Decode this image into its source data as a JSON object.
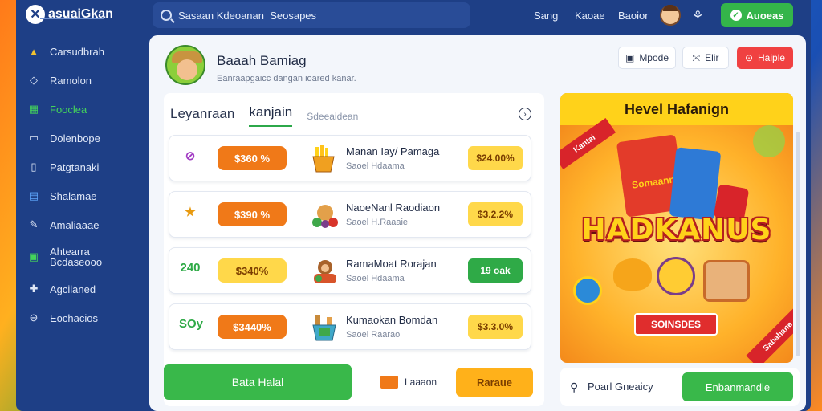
{
  "app": {
    "name": "asuaiGkan"
  },
  "search": {
    "placeholder": "Sasaan Kdeoanan  Seosapes"
  },
  "topnav": {
    "links": [
      "Sang",
      "Kaoae",
      "Baoior"
    ],
    "cta": "Auoeas"
  },
  "sidebar": {
    "items": [
      {
        "label": "Carsudbrah",
        "icon": "hat-icon"
      },
      {
        "label": "Ramolon",
        "icon": "flag-icon"
      },
      {
        "label": "Fooclea",
        "icon": "chart-icon",
        "active": true
      },
      {
        "label": "Dolenbope",
        "icon": "card-icon"
      },
      {
        "label": "Patgtanaki",
        "icon": "doc-icon"
      },
      {
        "label": "Shalamae",
        "icon": "grid-icon"
      },
      {
        "label": "Amaliaaae",
        "icon": "pen-icon"
      },
      {
        "label": "Ahtearra\nBcdaseooo",
        "icon": "image-icon"
      },
      {
        "label": "Agcilaned",
        "icon": "puzzle-icon"
      },
      {
        "label": "Eochacios",
        "icon": "minus-circle-icon"
      }
    ]
  },
  "profile": {
    "name": "Baaah Bamiag",
    "subtitle": "Eanraapgaicc dangan ioared kanar."
  },
  "header_buttons": {
    "mode": "Mpode",
    "edit": "Elir",
    "help": "Haiple"
  },
  "tabs": {
    "items": [
      "Leyanraan",
      "kanjain",
      "Sdeeaidean"
    ]
  },
  "rows": [
    {
      "lead": "",
      "lead_icon": "refresh-icon",
      "pill": "$360 %",
      "pill_style": "orange",
      "thumb": "fries-icon",
      "title": "Manan Iay/ Pamaga",
      "sub": "Saoel Hdaama",
      "badge": "$24.00%",
      "badge_style": "yellow"
    },
    {
      "lead": "",
      "lead_icon": "star-icon",
      "pill": "$390 %",
      "pill_style": "orange",
      "thumb": "creature-icon",
      "title": "NaoeNanl Raodiaon",
      "sub": "Saoel H.Raaaie",
      "badge": "$3.2.2%",
      "badge_style": "yellow"
    },
    {
      "lead": "240",
      "lead_icon": "",
      "pill": "$340%",
      "pill_style": "yellow",
      "thumb": "monkey-icon",
      "title": "RamaMoat Rorajan",
      "sub": "Saoel Hdaama",
      "badge": "19 oak",
      "badge_style": "green"
    },
    {
      "lead": "SOy",
      "lead_icon": "",
      "pill": "$3440%",
      "pill_style": "orange",
      "thumb": "basket-icon",
      "title": "Kumaokan Bomdan",
      "sub": "Saoel Raarao",
      "badge": "$3.3.0%",
      "badge_style": "yellow"
    }
  ],
  "actions": {
    "primary": "Bata Halal",
    "secondary_label": "Laaaon",
    "secondary_button": "Raraue"
  },
  "promo": {
    "header": "Hevel Hafanign",
    "ribbon_left": "Kantai",
    "pack_label": "Somaann",
    "brand": "HADKANUS",
    "button": "SOINSDES",
    "ribbon_right": "Sabahane"
  },
  "footer_right": {
    "label": "Poarl Gneaicy",
    "button": "Enbanmandie"
  },
  "colors": {
    "accent_green": "#39b84a",
    "accent_orange": "#f07918",
    "accent_red": "#f04141",
    "brand_blue": "#1e3f86"
  }
}
